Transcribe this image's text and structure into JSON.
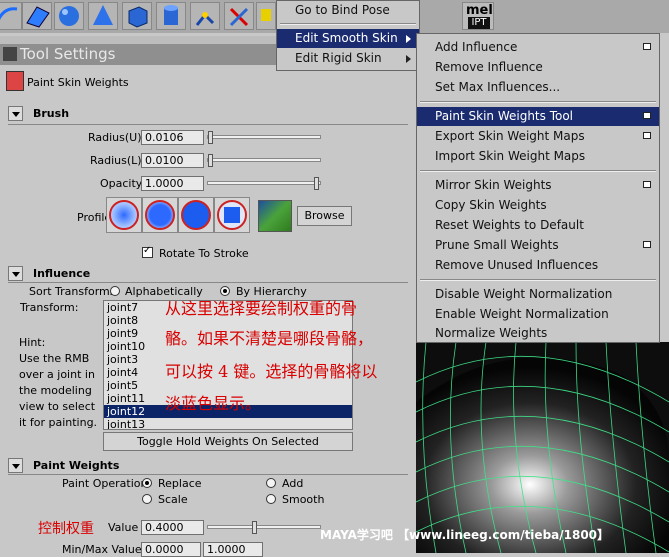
{
  "tool_settings": {
    "title": "Tool Settings",
    "tool_name": "Paint Skin Weights"
  },
  "brush": {
    "title": "Brush",
    "radius_u_label": "Radius(U)",
    "radius_u_value": "0.0106",
    "radius_l_label": "Radius(L)",
    "radius_l_value": "0.0100",
    "opacity_label": "Opacity",
    "opacity_value": "1.0000",
    "profile_label": "Profile",
    "browse_label": "Browse",
    "rotate_to_stroke_label": "Rotate To Stroke",
    "rotate_to_stroke_checked": true
  },
  "influence": {
    "title": "Influence",
    "sort_label": "Sort Transforms",
    "sort_alpha": "Alphabetically",
    "sort_hier": "By Hierarchy",
    "transform_label": "Transform:",
    "hint_lines": [
      "Hint:",
      "Use the RMB",
      "over a joint in",
      "the modeling",
      "view to select",
      "it for painting."
    ],
    "joints": [
      "joint7",
      "joint8",
      "joint9",
      "joint10",
      "joint3",
      "joint4",
      "joint5",
      "joint11",
      "joint12",
      "joint13"
    ],
    "selected_joint": "joint12",
    "toggle_hold_label": "Toggle Hold Weights On Selected"
  },
  "paint_weights": {
    "title": "Paint Weights",
    "operation_label": "Paint Operation",
    "op_replace": "Replace",
    "op_add": "Add",
    "op_scale": "Scale",
    "op_smooth": "Smooth",
    "value_label": "Value",
    "value": "0.4000",
    "minmax_label": "Min/Max Value",
    "min_value": "0.0000",
    "max_value": "1.0000"
  },
  "annotations": {
    "line1": "从这里选择要绘制权重的骨",
    "line2": "骼。如果不清楚是哪段骨骼，",
    "line3": "可以按 4 键。选择的骨骼将以",
    "line4": "淡蓝色显示。",
    "control_weight": "控制权重"
  },
  "menu_level1": {
    "go_to_bind_pose": "Go to Bind Pose",
    "edit_smooth_skin": "Edit Smooth Skin",
    "edit_rigid_skin": "Edit Rigid Skin"
  },
  "mel_label": "mel",
  "ipt_label": "IPT",
  "menu_level2": {
    "add_influence": "Add Influence",
    "remove_influence": "Remove Influence",
    "set_max_influences": "Set Max Influences...",
    "paint_skin_weights_tool": "Paint Skin Weights Tool",
    "export_skin_weight_maps": "Export Skin Weight Maps",
    "import_skin_weight_maps": "Import Skin Weight Maps",
    "mirror_skin_weights": "Mirror Skin Weights",
    "copy_skin_weights": "Copy Skin Weights",
    "reset_weights_to_default": "Reset Weights to Default",
    "prune_small_weights": "Prune Small Weights",
    "remove_unused_influences": "Remove Unused Influences",
    "disable_weight_normalization": "Disable Weight Normalization",
    "enable_weight_normalization": "Enable Weight Normalization",
    "normalize_weights": "Normalize Weights"
  },
  "watermark": "MAYA学习吧  【www.lineeg.com/tieba/1800】",
  "colors": {
    "menu_highlight": "#1a2c6f",
    "list_selection": "#0b2468",
    "annotation_red": "#d80000",
    "wire_green": "#3fe38a"
  }
}
